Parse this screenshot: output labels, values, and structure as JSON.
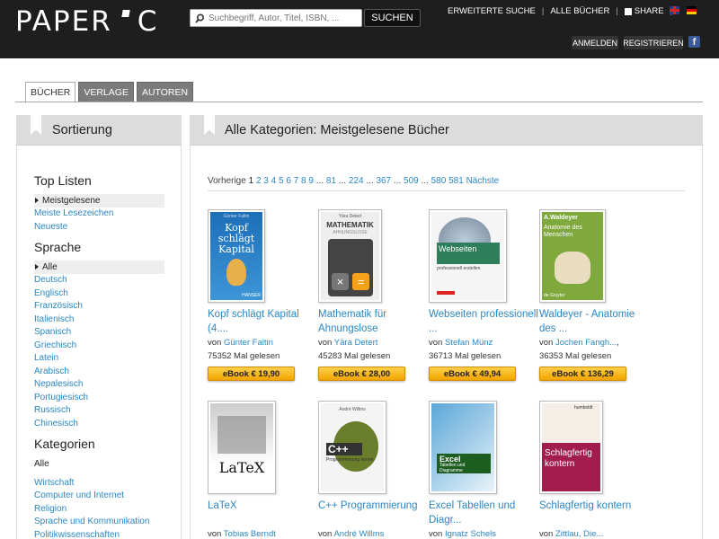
{
  "header": {
    "logo_left": "PAPER",
    "logo_right": "C",
    "search_placeholder": "Suchbegriff, Autor, Titel, ISBN, ...",
    "search_button": "SUCHEN",
    "links": [
      "ERWEITERTE SUCHE",
      "ALLE BÜCHER",
      "SHARE"
    ],
    "login": "ANMELDEN",
    "register": "REGISTRIEREN"
  },
  "tabs": [
    "BÜCHER",
    "VERLAGE",
    "AUTOREN"
  ],
  "sidebar": {
    "title": "Sortierung",
    "toplisten_title": "Top Listen",
    "toplisten": [
      "Meistgelesene",
      "Meiste Lesezeichen",
      "Neueste"
    ],
    "sprache_title": "Sprache",
    "sprache": [
      "Alle",
      "Deutsch",
      "Englisch",
      "Französisch",
      "Italienisch",
      "Spanisch",
      "Griechisch",
      "Latein",
      "Arabisch",
      "Nepalesisch",
      "Portugiesisch",
      "Russisch",
      "Chinesisch"
    ],
    "kategorien_title": "Kategorien",
    "kategorien_all": "Alle",
    "kategorien": [
      "Wirtschaft",
      "Computer und Internet",
      "Religion",
      "Sprache und Kommunikation",
      "Politikwissenschaften"
    ]
  },
  "main": {
    "title": "Alle Kategorien: Meistgelesene Bücher",
    "pager": {
      "prev": "Vorherige",
      "current": "1",
      "pages": [
        "2",
        "3",
        "4",
        "5",
        "6",
        "7",
        "8",
        "9"
      ],
      "mid": [
        "81",
        "224",
        "367",
        "509"
      ],
      "end": [
        "580",
        "581"
      ],
      "dots": "...",
      "next": "Nächste"
    },
    "books": [
      {
        "title": "Kopf schlägt Kapital (4....",
        "by": "von",
        "author": "Günter Faltin",
        "author_suffix": "",
        "reads": "75352 Mal gelesen",
        "price": "eBook € 19,90",
        "cover_text": "Kopf schlägt Kapital",
        "cover_top": "Günter Faltin",
        "cover_bottom": "HANSER"
      },
      {
        "title": "Mathematik für Ahnungslose",
        "by": "von",
        "author": "Yära Detert",
        "author_suffix": "",
        "reads": "45283 Mal gelesen",
        "price": "eBook € 28,00",
        "cover_text": "MATHEMATIK",
        "cover_top": "Yära Detert",
        "cover_bottom": "AHNUNGSLOSE"
      },
      {
        "title": "Webseiten professionell ...",
        "by": "von",
        "author": "Stefan Münz",
        "author_suffix": "",
        "reads": "36713 Mal gelesen",
        "price": "eBook € 49,94",
        "cover_text": "Webseiten",
        "cover_top": "",
        "cover_bottom": "professionell erstellen"
      },
      {
        "title": "Waldeyer - Anatomie des ...",
        "by": "von",
        "author": "Jochen Fangh...",
        "author_suffix": ",",
        "reads": "36353 Mal gelesen",
        "price": "eBook € 136,29",
        "cover_text": "Anatomie des Menschen",
        "cover_top": "A.Waldeyer",
        "cover_bottom": "de Gruyter"
      },
      {
        "title": "LaTeX",
        "by": "von",
        "author": "Tobias Berndt",
        "author_suffix": "",
        "reads": "",
        "price": "",
        "cover_text": "LaTeX",
        "cover_top": "",
        "cover_bottom": ""
      },
      {
        "title": "C++ Programmierung",
        "by": "von",
        "author": "André Willms",
        "author_suffix": "",
        "reads": "",
        "price": "",
        "cover_text": "C++",
        "cover_top": "André Willms",
        "cover_bottom": "Programmierung lernen"
      },
      {
        "title": "Excel Tabellen und Diagr...",
        "by": "von",
        "author": "Ignatz Schels",
        "author_suffix": "",
        "reads": "",
        "price": "",
        "cover_text": "Excel",
        "cover_top": "",
        "cover_bottom": "Tabellen und Diagramme"
      },
      {
        "title": "Schlagfertig kontern",
        "by": "von",
        "author": "Zittlau, Die...",
        "author_suffix": "",
        "reads": "",
        "price": "",
        "cover_text": "Schlagfertig kontern",
        "cover_top": "humboldt",
        "cover_bottom": ""
      }
    ]
  },
  "colors": {
    "accent": "#2a87c4",
    "header_bg": "#1e1e1e",
    "button_orange": "#f3a400"
  }
}
